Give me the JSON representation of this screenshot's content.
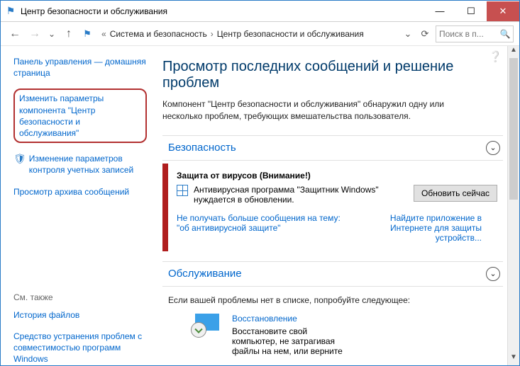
{
  "titlebar": {
    "title": "Центр безопасности и обслуживания"
  },
  "breadcrumbs": {
    "root_sep": "«",
    "item1": "Система и безопасность",
    "item2": "Центр безопасности и обслуживания"
  },
  "search": {
    "placeholder": "Поиск в п..."
  },
  "sidebar": {
    "home": "Панель управления — домашняя страница",
    "change_settings": "Изменить параметры компонента \"Центр безопасности и обслуживания\"",
    "uac": "Изменение параметров контроля учетных записей",
    "archive": "Просмотр архива сообщений",
    "seealso_title": "См. также",
    "seealso1": "История файлов",
    "seealso2": "Средство устранения проблем с совместимостью программ Windows"
  },
  "main": {
    "title": "Просмотр последних сообщений и решение проблем",
    "subtitle": "Компонент \"Центр безопасности и обслуживания\" обнаружил одну или несколько проблем, требующих вмешательства пользователя.",
    "security": {
      "heading": "Безопасность",
      "alert_title": "Защита от вирусов  (Внимание!)",
      "alert_text": "Антивирусная программа \"Защитник Windows\" нуждается в обновлении.",
      "button": "Обновить сейчас",
      "link_left": "Не получать больше сообщения на тему: \"об антивирусной защите\"",
      "link_right": "Найдите приложение в Интернете для защиты устройств..."
    },
    "maintenance": {
      "heading": "Обслуживание",
      "hint": "Если вашей проблемы нет в списке, попробуйте следующее:",
      "recovery_title": "Восстановление",
      "recovery_text": "Восстановите свой компьютер, не затрагивая файлы на нем, или верните"
    }
  }
}
